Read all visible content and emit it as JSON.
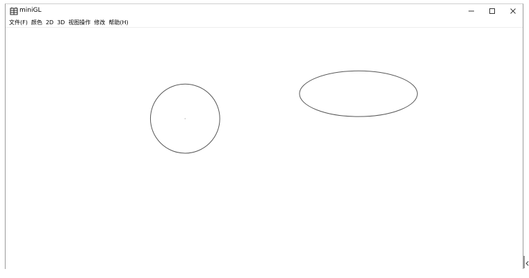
{
  "window": {
    "title": "miniGL"
  },
  "menu": {
    "items": [
      "文件(F)",
      "颜色",
      "2D",
      "3D",
      "视图操作",
      "修改",
      "帮助(H)"
    ]
  },
  "controls": {
    "minimize_icon": "minimize-icon",
    "maximize_icon": "maximize-icon",
    "close_icon": "close-icon"
  },
  "canvas": {
    "stroke_color": "#555555",
    "center_dot_color": "#bbbbbb"
  }
}
